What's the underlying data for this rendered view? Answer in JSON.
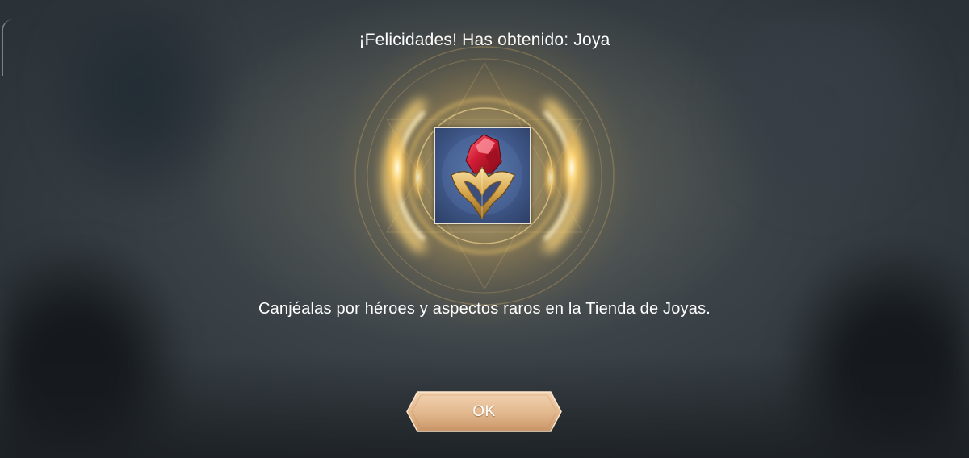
{
  "dialog": {
    "title": "¡Felicidades! Has obtenido: Joya",
    "item_icon": "gem-icon",
    "message": "Canjéalas por héroes y aspectos raros en la Tienda de Joyas.",
    "ok_label": "OK"
  },
  "colors": {
    "glow": "#f5c35a",
    "frame_bg": "#40598a",
    "gem_red": "#c2182b",
    "gold": "#d9a94e",
    "button_fill": "#e8c09a",
    "text": "#ffffff"
  }
}
